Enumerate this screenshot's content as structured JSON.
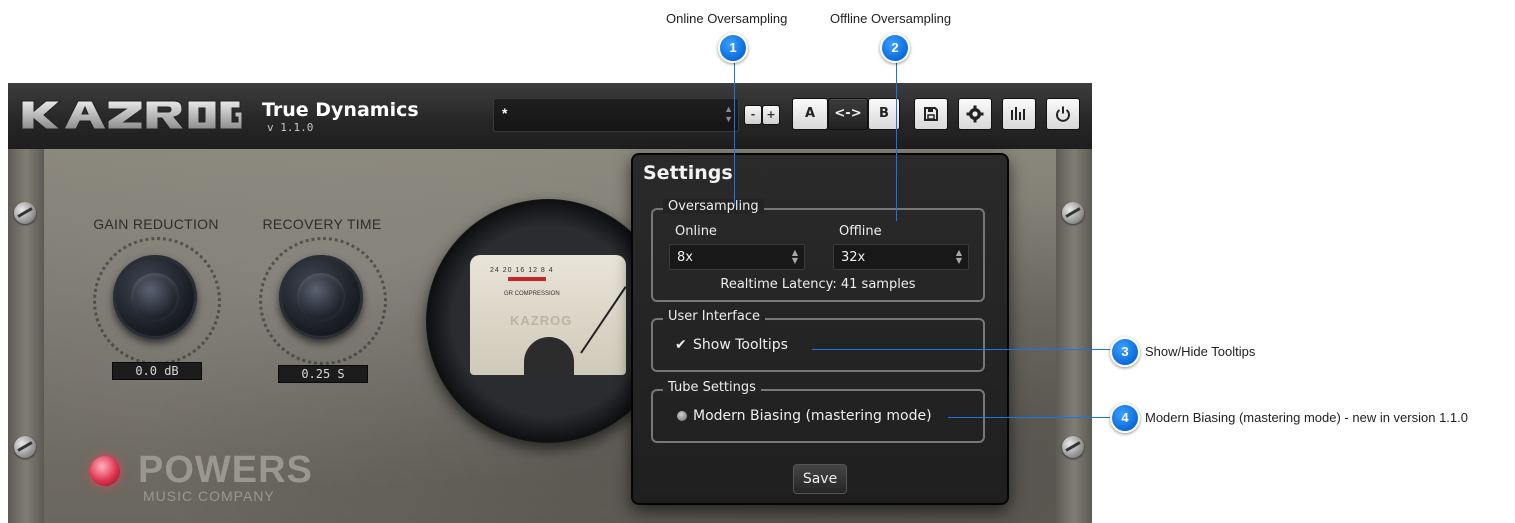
{
  "annotations": [
    {
      "number": "1",
      "label": "Online Oversampling"
    },
    {
      "number": "2",
      "label": "Offline Oversampling"
    },
    {
      "number": "3",
      "label": "Show/Hide Tooltips"
    },
    {
      "number": "4",
      "label": "Modern Biasing (mastering mode) - new in version 1.1.0"
    }
  ],
  "topbar": {
    "logo": "KAZROG",
    "product_name": "True Dynamics",
    "version": "v 1.1.0",
    "preset_value": "*",
    "minus_label": "-",
    "plus_label": "+",
    "a_label": "A",
    "copy_label": "<->",
    "b_label": "B",
    "icons": [
      "save-icon",
      "gear-icon",
      "meter-icon",
      "power-icon"
    ]
  },
  "faceplate": {
    "gain_reduction_label": "GAIN REDUCTION",
    "gain_reduction_value": "0.0 dB",
    "recovery_time_label": "RECOVERY TIME",
    "recovery_time_value": "0.25 S",
    "vu_scale": "24 20 16 12 8 4",
    "vu_text": "GR COMPRESSION",
    "vu_brand": "KAZROG",
    "brand_name": "POWERS",
    "brand_sub": "MUSIC COMPANY"
  },
  "settings": {
    "title": "Settings",
    "oversampling": {
      "title": "Oversampling",
      "online_label": "Online",
      "online_value": "8x",
      "offline_label": "Offline",
      "offline_value": "32x",
      "latency": "Realtime Latency: 41 samples"
    },
    "user_interface": {
      "title": "User Interface",
      "show_tooltips": "Show Tooltips",
      "show_tooltips_checked": true
    },
    "tube_settings": {
      "title": "Tube Settings",
      "modern_biasing": "Modern Biasing (mastering mode)"
    },
    "save_label": "Save"
  },
  "colors": {
    "badge": "#0b6bd8",
    "leader": "#1a73e8",
    "vu_red": "#c0282a"
  }
}
